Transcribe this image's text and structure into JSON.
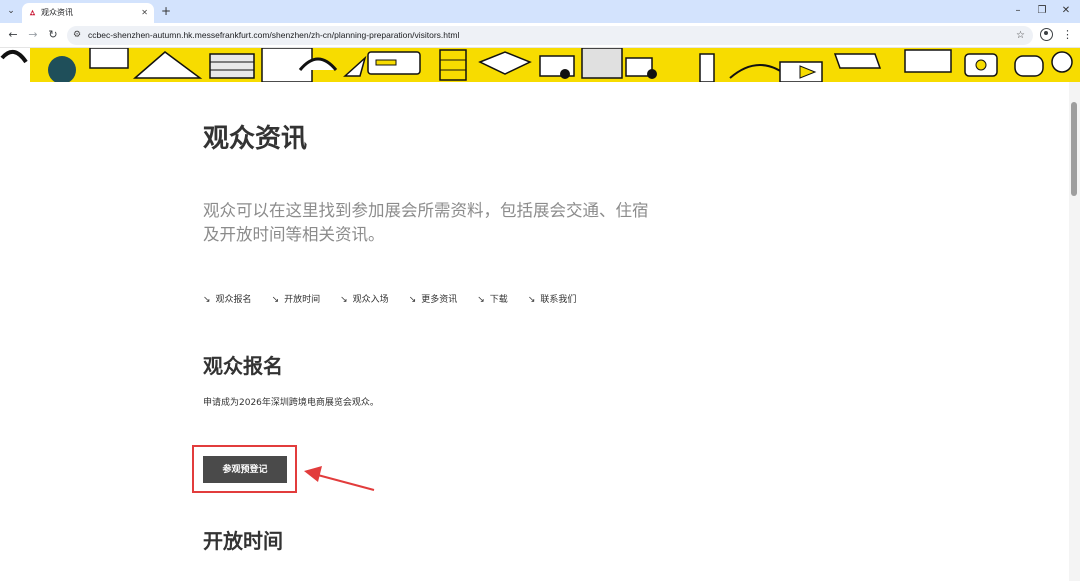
{
  "browser": {
    "tab_title": "观众资讯",
    "url": "ccbec-shenzhen-autumn.hk.messefrankfurt.com/shenzhen/zh-cn/planning-preparation/visitors.html"
  },
  "page": {
    "title": "观众资讯",
    "intro": "观众可以在这里找到参加展会所需资料，包括展会交通、住宿及开放时间等相关资讯。",
    "anchors": [
      {
        "label": "观众报名"
      },
      {
        "label": "开放时间"
      },
      {
        "label": "观众入场"
      },
      {
        "label": "更多资讯"
      },
      {
        "label": "下载"
      },
      {
        "label": "联系我们"
      }
    ],
    "sections": [
      {
        "title": "观众报名",
        "body": "申请成为2026年深圳跨境电商展览会观众。",
        "button_label": "参观预登记"
      },
      {
        "title": "开放时间"
      }
    ]
  },
  "colors": {
    "banner_yellow": "#f7dc00",
    "button_bg": "#4a4a4a",
    "annotation_red": "#e23c3c",
    "intro_gray": "#8c8c8c"
  },
  "icons": {
    "anchor_arrow": "↘"
  }
}
